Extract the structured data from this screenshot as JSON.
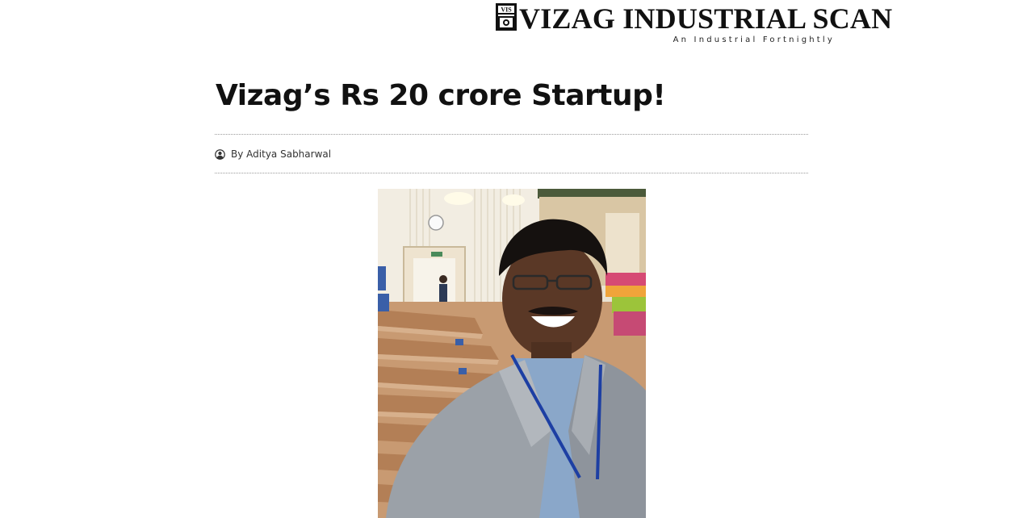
{
  "masthead": {
    "logo_text": "VIZAG INDUSTRIAL SCAN",
    "tagline": "An Industrial Fortnightly",
    "logo_mark_letters": "VIS"
  },
  "article": {
    "title": "Vizag’s Rs 20 crore Startup!",
    "byline_prefix": "By",
    "author": "Aditya Sabharwal",
    "author_icon": "user-circle-icon",
    "featured_image": "photo of a smiling man in a grey blazer with blue lanyard inside an auditorium"
  },
  "colors": {
    "text": "#111111",
    "byline": "#333333",
    "rule": "#9a9a9a",
    "background": "#ffffff"
  }
}
